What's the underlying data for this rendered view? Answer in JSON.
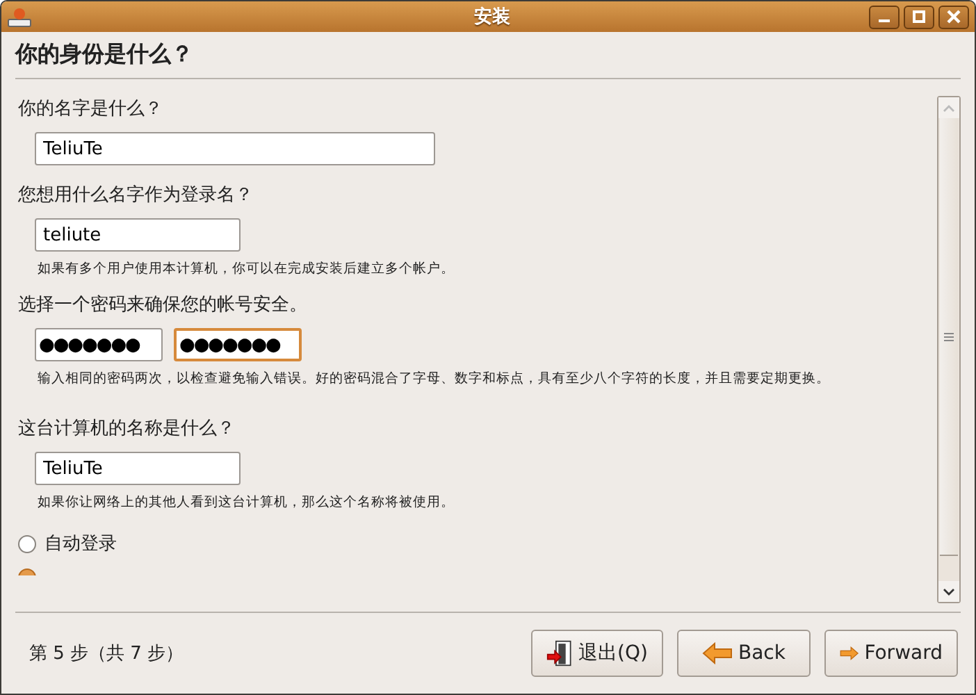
{
  "window": {
    "title": "安装"
  },
  "heading": "你的身份是什么？",
  "sections": [
    {
      "label": "你的名字是什么？",
      "fields": [
        {
          "value": "TeliuTe",
          "kind": "text",
          "focused": false
        }
      ]
    },
    {
      "label": "您想用什么名字作为登录名？",
      "fields": [
        {
          "value": "teliute",
          "kind": "text",
          "focused": false
        }
      ],
      "hint": "如果有多个用户使用本计算机，你可以在完成安装后建立多个帐户。"
    },
    {
      "label": "选择一个密码来确保您的帐号安全。",
      "fields": [
        {
          "value": "●●●●●●●",
          "kind": "password",
          "focused": false
        },
        {
          "value": "●●●●●●●",
          "kind": "password",
          "focused": true
        }
      ],
      "hint": "输入相同的密码两次，以检查避免输入错误。好的密码混合了字母、数字和标点，具有至少八个字符的长度，并且需要定期更换。"
    },
    {
      "label": "这台计算机的名称是什么？",
      "fields": [
        {
          "value": "TeliuTe",
          "kind": "text",
          "focused": false
        }
      ],
      "hint": "如果你让网络上的其他人看到这台计算机，那么这个名称将被使用。"
    }
  ],
  "radios": [
    {
      "label": "自动登录",
      "selected": false
    },
    {
      "selected": true
    }
  ],
  "step": "第 5 步（共 7 步）",
  "buttons": [
    {
      "label": "退出(Q)",
      "kind": "quit"
    },
    {
      "label": "Back",
      "kind": "back"
    },
    {
      "label": "Forward",
      "kind": "forward"
    }
  ]
}
